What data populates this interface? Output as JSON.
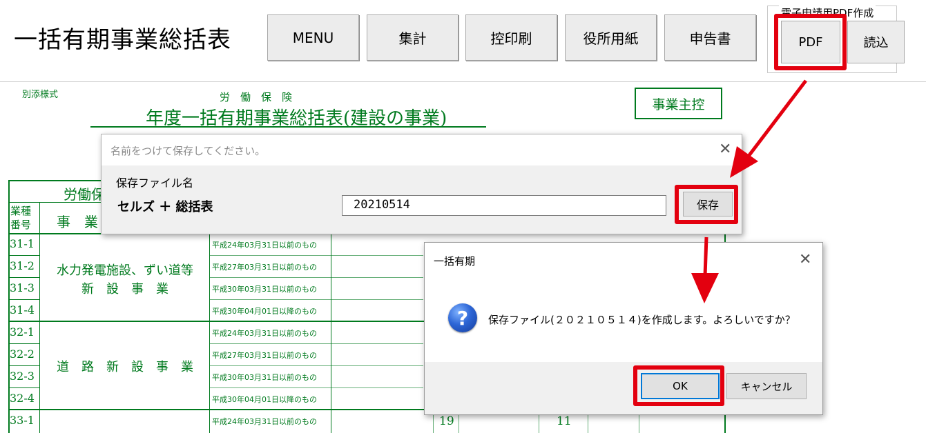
{
  "toolbar": {
    "title": "一括有期事業総括表",
    "buttons": {
      "menu": "MENU",
      "tally": "集計",
      "copy_print": "控印刷",
      "office_paper": "役所用紙",
      "declaration": "申告書"
    },
    "pdf_group": {
      "legend": "電子申請用PDF作成",
      "pdf": "PDF",
      "load": "読込"
    }
  },
  "sheet": {
    "attachment": "別添様式",
    "header_small": "労　働　保　険",
    "form_title": "年度一括有期事業総括表(建設の事業)",
    "owner_copy": "事業主控",
    "table_header_partial": "労働保",
    "col_code": [
      "業種",
      "番号"
    ],
    "col_business": "事　業",
    "row_codes": [
      "31-1",
      "31-2",
      "31-3",
      "31-4",
      "32-1",
      "32-2",
      "32-3",
      "32-4",
      "33-1"
    ],
    "era_labels": [
      "平成24年03月31日以前のもの",
      "平成27年03月31日以前のもの",
      "平成30年03月31日以前のもの",
      "平成30年04月01日以降のもの",
      "平成24年03月31日以前のもの",
      "平成27年03月31日以前のもの",
      "平成30年03月31日以前のもの",
      "平成30年04月01日以降のもの",
      "平成24年03月31日以前のもの"
    ],
    "industry_31_line1": "水力発電施設、ずい道等",
    "industry_31_line2": "新　設　事　業",
    "industry_32": "道　路　新　設　事　業",
    "row33_values": [
      "19",
      "11"
    ]
  },
  "save_dialog": {
    "title": "名前をつけて保存してください。",
    "label": "保存ファイル名",
    "prefix": "セルズ ＋ 総括表",
    "filename_value": "20210514",
    "save_button": "保存"
  },
  "confirm_dialog": {
    "title": "一括有期",
    "message": "保存ファイル(２０２１０５１４)を作成します。よろしいですか？",
    "ok": "OK",
    "cancel": "キャンセル"
  },
  "colors": {
    "sheet_green": "#007a1e",
    "highlight_red": "#e3000f",
    "focus_blue": "#0078d7"
  },
  "icons": [
    "question-icon",
    "close-icon"
  ]
}
